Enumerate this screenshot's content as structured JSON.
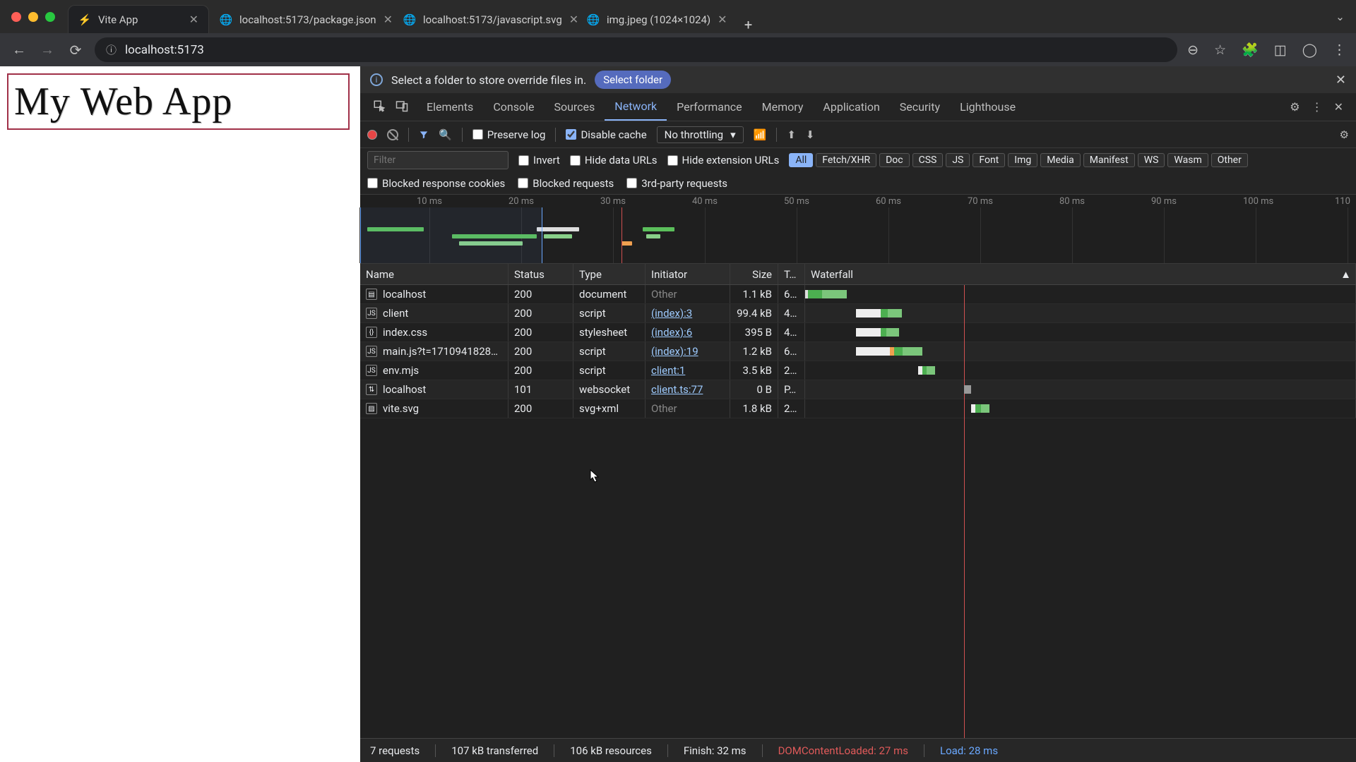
{
  "window": {
    "tabs": [
      {
        "title": "Vite App",
        "active": true
      },
      {
        "title": "localhost:5173/package.json",
        "active": false
      },
      {
        "title": "localhost:5173/javascript.svg",
        "active": false
      },
      {
        "title": "img.jpeg (1024×1024)",
        "active": false
      }
    ],
    "url": "localhost:5173"
  },
  "page": {
    "heading": "My Web App"
  },
  "infobar": {
    "message": "Select a folder to store override files in.",
    "button": "Select folder"
  },
  "devtools": {
    "tabs": [
      "Elements",
      "Console",
      "Sources",
      "Network",
      "Performance",
      "Memory",
      "Application",
      "Security",
      "Lighthouse"
    ],
    "active": "Network"
  },
  "toolbar": {
    "preserve_log": "Preserve log",
    "disable_cache": "Disable cache",
    "throttling": "No throttling"
  },
  "filters": {
    "placeholder": "Filter",
    "invert": "Invert",
    "hide_data": "Hide data URLs",
    "hide_ext": "Hide extension URLs",
    "types": [
      "All",
      "Fetch/XHR",
      "Doc",
      "CSS",
      "JS",
      "Font",
      "Img",
      "Media",
      "Manifest",
      "WS",
      "Wasm",
      "Other"
    ],
    "active_type": "All",
    "blocked_cookies": "Blocked response cookies",
    "blocked_req": "Blocked requests",
    "third_party": "3rd-party requests"
  },
  "timeline": {
    "ticks": [
      "10 ms",
      "20 ms",
      "30 ms",
      "40 ms",
      "50 ms",
      "60 ms",
      "70 ms",
      "80 ms",
      "90 ms",
      "100 ms",
      "110"
    ]
  },
  "columns": {
    "name": "Name",
    "status": "Status",
    "type": "Type",
    "initiator": "Initiator",
    "size": "Size",
    "time": "T…",
    "waterfall": "Waterfall"
  },
  "requests": [
    {
      "name": "localhost",
      "status": "200",
      "type": "document",
      "initiator": "Other",
      "init_link": false,
      "size": "1.1 kB",
      "time": "6…",
      "wf_start": 0,
      "wf": [
        [
          "#ddd",
          4
        ],
        [
          "#4caf50",
          20
        ],
        [
          "#7bc67b",
          35
        ]
      ]
    },
    {
      "name": "client",
      "status": "200",
      "type": "script",
      "initiator": "(index):3",
      "init_link": true,
      "size": "99.4 kB",
      "time": "4…",
      "wf_start": 72,
      "wf": [
        [
          "#eee",
          35
        ],
        [
          "#4caf50",
          10
        ],
        [
          "#7bc67b",
          20
        ]
      ]
    },
    {
      "name": "index.css",
      "status": "200",
      "type": "stylesheet",
      "initiator": "(index):6",
      "init_link": true,
      "size": "395 B",
      "time": "4…",
      "wf_start": 72,
      "wf": [
        [
          "#eee",
          35
        ],
        [
          "#4caf50",
          8
        ],
        [
          "#7bc67b",
          18
        ]
      ]
    },
    {
      "name": "main.js?t=1710941828…",
      "status": "200",
      "type": "script",
      "initiator": "(index):19",
      "init_link": true,
      "size": "1.2 kB",
      "time": "6…",
      "wf_start": 72,
      "wf": [
        [
          "#eee",
          48
        ],
        [
          "#f0a050",
          6
        ],
        [
          "#4caf50",
          12
        ],
        [
          "#7bc67b",
          28
        ]
      ]
    },
    {
      "name": "env.mjs",
      "status": "200",
      "type": "script",
      "initiator": "client:1",
      "init_link": true,
      "size": "3.5 kB",
      "time": "2…",
      "wf_start": 160,
      "wf": [
        [
          "#eee",
          6
        ],
        [
          "#4caf50",
          6
        ],
        [
          "#7bc67b",
          12
        ]
      ]
    },
    {
      "name": "localhost",
      "status": "101",
      "type": "websocket",
      "initiator": "client.ts:77",
      "init_link": true,
      "size": "0 B",
      "time": "P…",
      "wf_start": 225,
      "wf": [
        [
          "#999",
          10
        ]
      ]
    },
    {
      "name": "vite.svg",
      "status": "200",
      "type": "svg+xml",
      "initiator": "Other",
      "init_link": false,
      "size": "1.8 kB",
      "time": "2…",
      "wf_start": 235,
      "wf": [
        [
          "#eee",
          6
        ],
        [
          "#4caf50",
          8
        ],
        [
          "#7bc67b",
          12
        ]
      ]
    }
  ],
  "status": {
    "requests": "7 requests",
    "transferred": "107 kB transferred",
    "resources": "106 kB resources",
    "finish": "Finish: 32 ms",
    "dcl": "DOMContentLoaded: 27 ms",
    "load": "Load: 28 ms"
  }
}
